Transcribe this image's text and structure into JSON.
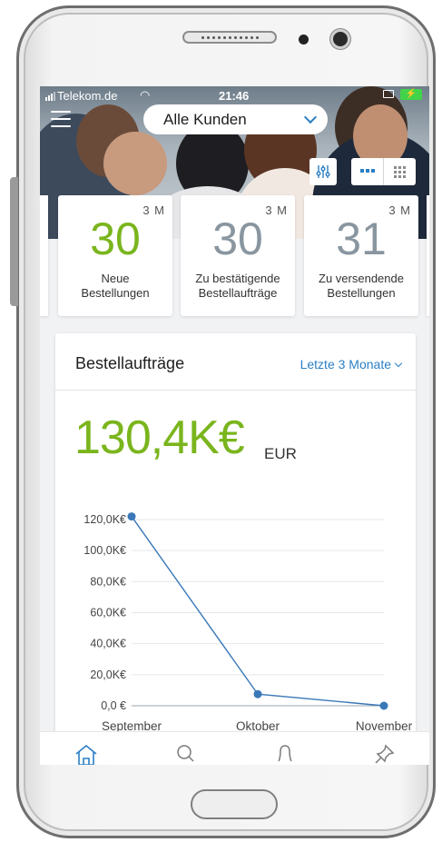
{
  "status_bar": {
    "carrier": "Telekom.de",
    "time": "21:46"
  },
  "header": {
    "customer_filter": "Alle Kunden",
    "icons": {
      "menu": "hamburger-icon",
      "filter": "sliders-icon",
      "view_list": "list-view-icon",
      "view_grid": "grid-view-icon"
    }
  },
  "kpis": [
    {
      "value": "30",
      "period": "3 M",
      "label_line1": "Neue",
      "label_line2": "Bestellungen",
      "color": "#7ab51d"
    },
    {
      "value": "30",
      "period": "3 M",
      "label_line1": "Zu bestätigende",
      "label_line2": "Bestellaufträge",
      "color": "#8996a0"
    },
    {
      "value": "31",
      "period": "3 M",
      "label_line1": "Zu versendende",
      "label_line2": "Bestellungen",
      "color": "#8996a0"
    }
  ],
  "orders_card": {
    "title": "Bestellaufträge",
    "range_label": "Letzte 3 Monate",
    "total": "130,4K€",
    "currency": "EUR"
  },
  "chart_data": {
    "type": "line",
    "x": [
      "September",
      "Oktober",
      "November"
    ],
    "series": [
      {
        "values": [
          122,
          7.5,
          0
        ]
      }
    ],
    "ylim": [
      0,
      120
    ],
    "yticks": [
      0,
      20,
      40,
      60,
      80,
      100,
      120
    ],
    "ytick_labels": [
      "0,0 €",
      "20,0K€",
      "40,0K€",
      "60,0K€",
      "80,0K€",
      "100,0K€",
      "120,0K€"
    ],
    "grid": true,
    "line_color": "#3a78b8"
  },
  "tabbar": {
    "icons": [
      "home-icon",
      "search-icon",
      "bell-icon",
      "pin-icon"
    ]
  }
}
